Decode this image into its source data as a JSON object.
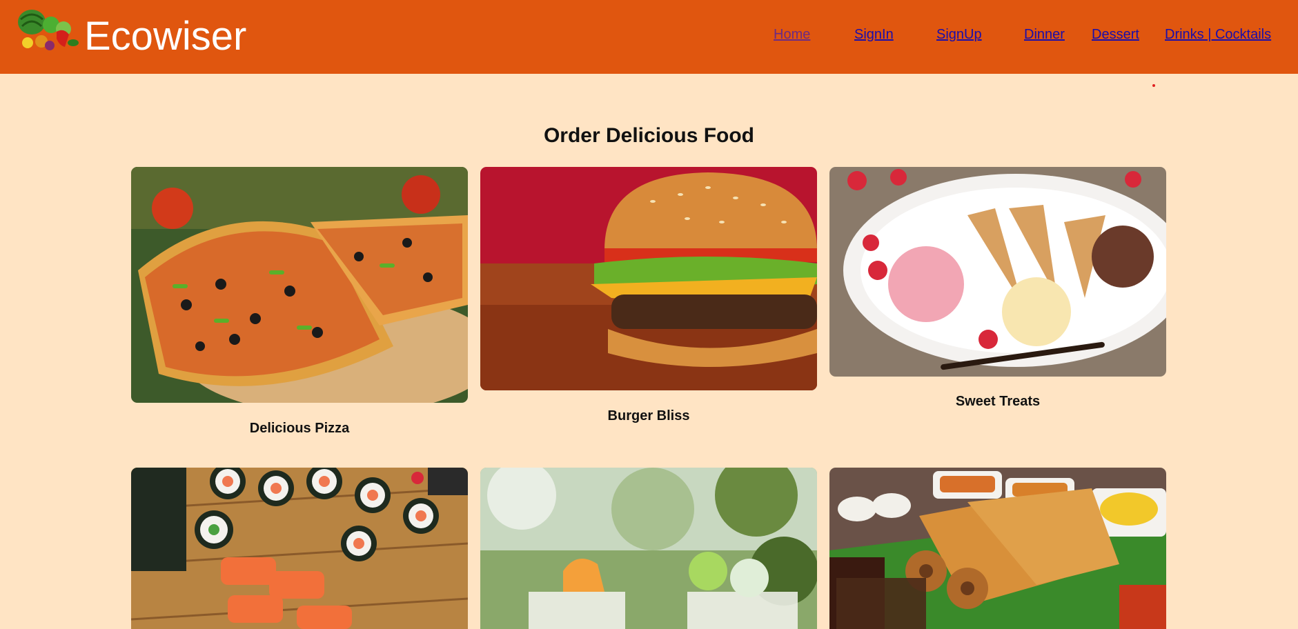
{
  "header": {
    "brand": "Ecowiser",
    "logo_icon": "vegetables-logo-icon",
    "background": "#e0560f"
  },
  "nav": {
    "home": "Home",
    "signin": "SignIn",
    "signup": "SignUp",
    "dinner": "Dinner",
    "dessert": "Dessert",
    "drinks": "Drinks | Cocktails"
  },
  "main": {
    "title": "Order Delicious Food",
    "cards": [
      {
        "caption": "Delicious Pizza",
        "image": "pizza-image"
      },
      {
        "caption": "Burger Bliss",
        "image": "burger-image"
      },
      {
        "caption": "Sweet Treats",
        "image": "ice-cream-image"
      },
      {
        "caption": "",
        "image": "sushi-image"
      },
      {
        "caption": "",
        "image": "cocktails-image"
      },
      {
        "caption": "",
        "image": "dosa-image"
      }
    ]
  },
  "colors": {
    "page_background": "#ffe4c4",
    "link": "#1a0dab",
    "visited_link": "#6b2a85"
  }
}
